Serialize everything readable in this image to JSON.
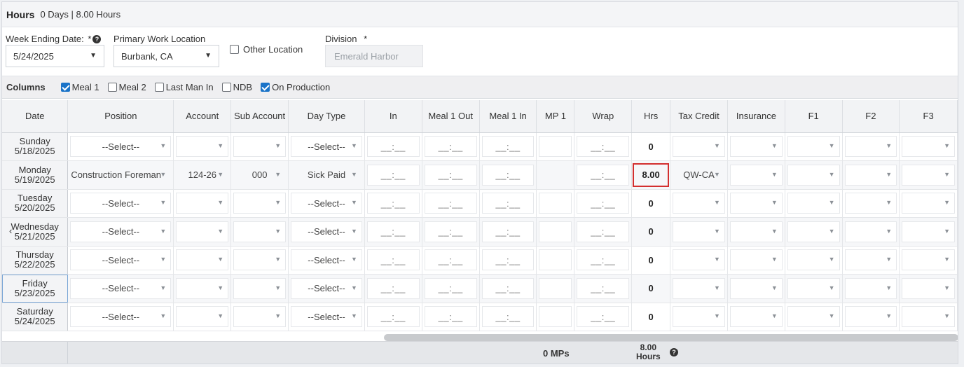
{
  "header": {
    "title": "Hours",
    "summary": "0 Days | 8.00 Hours"
  },
  "filters": {
    "week_ending_label": "Week Ending Date:",
    "week_ending_req": "*",
    "week_ending_value": "5/24/2025",
    "primary_location_label": "Primary Work Location",
    "primary_location_value": "Burbank, CA",
    "other_location_label": "Other Location",
    "division_label": "Division",
    "division_req": "*",
    "division_value": "Emerald Harbor"
  },
  "columns_bar": {
    "label": "Columns",
    "options": [
      {
        "label": "Meal 1",
        "checked": true
      },
      {
        "label": "Meal 2",
        "checked": false
      },
      {
        "label": "Last Man In",
        "checked": false
      },
      {
        "label": "NDB",
        "checked": false
      },
      {
        "label": "On Production",
        "checked": true
      }
    ]
  },
  "table": {
    "headers": [
      "Date",
      "Position",
      "Account",
      "Sub Account",
      "Day Type",
      "In",
      "Meal 1 Out",
      "Meal 1 In",
      "MP 1",
      "Wrap",
      "Hrs",
      "Tax Credit",
      "Insurance",
      "F1",
      "F2",
      "F3"
    ],
    "time_placeholder": "__:__",
    "rows": [
      {
        "day": "Sunday",
        "date": "5/18/2025",
        "position": "--Select--",
        "account": "",
        "sub_account": "",
        "day_type": "--Select--",
        "hrs": "0",
        "tax_credit": ""
      },
      {
        "day": "Monday",
        "date": "5/19/2025",
        "position": "Construction Foreman",
        "account": "124-26",
        "sub_account": "000",
        "day_type": "Sick Paid",
        "hrs": "8.00",
        "tax_credit": "QW-CA"
      },
      {
        "day": "Tuesday",
        "date": "5/20/2025",
        "position": "--Select--",
        "account": "",
        "sub_account": "",
        "day_type": "--Select--",
        "hrs": "0",
        "tax_credit": ""
      },
      {
        "day": "Wednesday",
        "date": "5/21/2025",
        "position": "--Select--",
        "account": "",
        "sub_account": "",
        "day_type": "--Select--",
        "hrs": "0",
        "tax_credit": ""
      },
      {
        "day": "Thursday",
        "date": "5/22/2025",
        "position": "--Select--",
        "account": "",
        "sub_account": "",
        "day_type": "--Select--",
        "hrs": "0",
        "tax_credit": ""
      },
      {
        "day": "Friday",
        "date": "5/23/2025",
        "position": "--Select--",
        "account": "",
        "sub_account": "",
        "day_type": "--Select--",
        "hrs": "0",
        "tax_credit": ""
      },
      {
        "day": "Saturday",
        "date": "5/24/2025",
        "position": "--Select--",
        "account": "",
        "sub_account": "",
        "day_type": "--Select--",
        "hrs": "0",
        "tax_credit": ""
      }
    ]
  },
  "footer": {
    "mps": "0 MPs",
    "total_hours": "8.00",
    "total_label": "Hours"
  },
  "colors": {
    "accent": "#1a73c8",
    "highlight": "#d32f2f"
  }
}
